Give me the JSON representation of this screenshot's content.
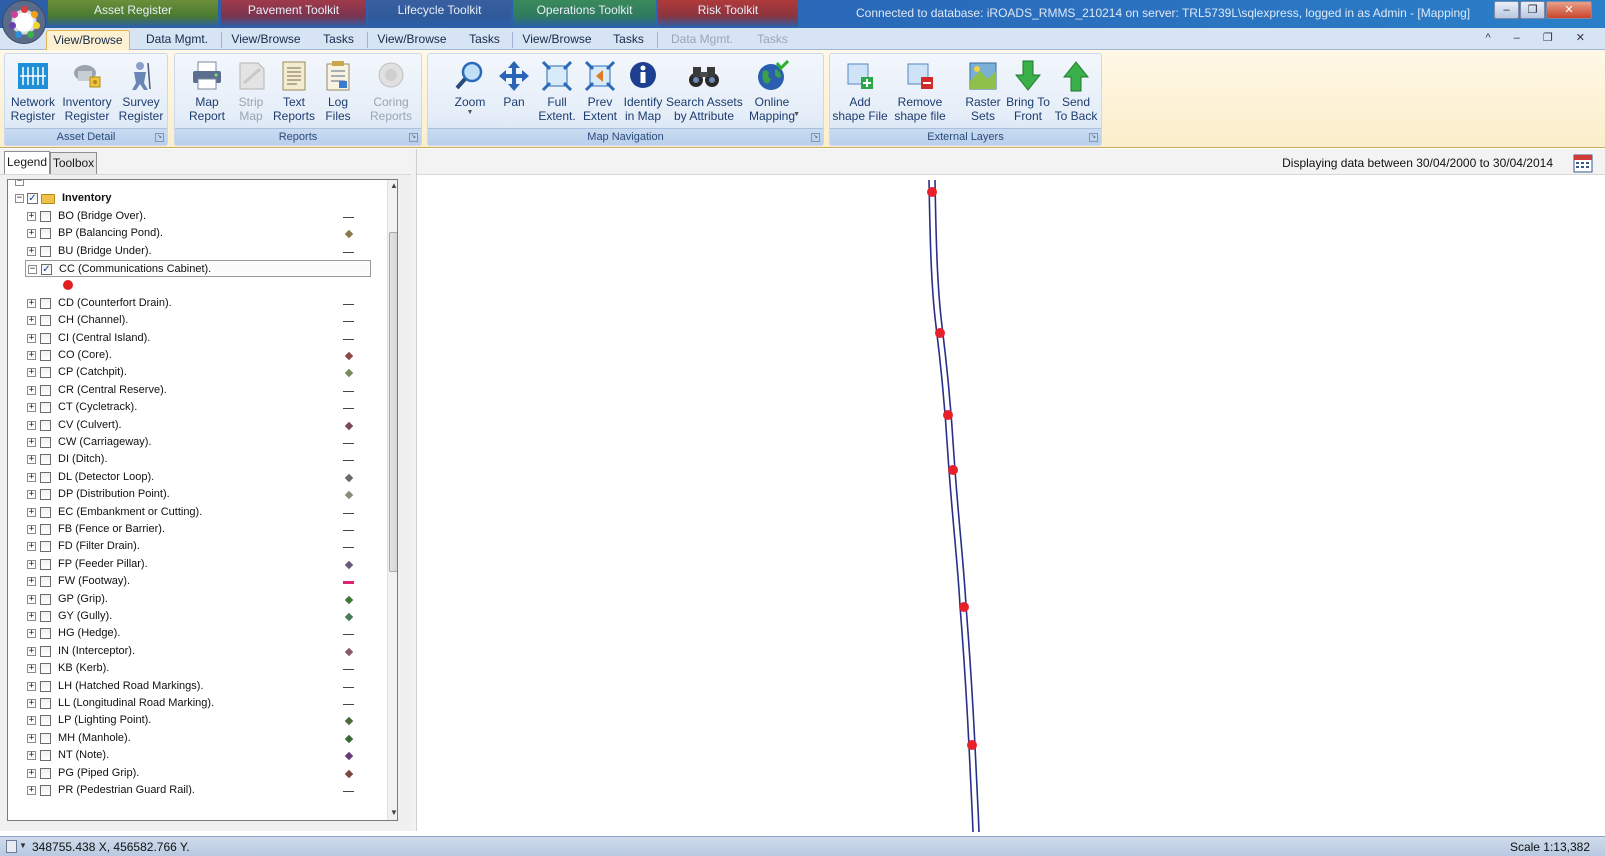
{
  "titlebar": {
    "context_tabs": [
      "Asset Register",
      "Pavement Toolkit",
      "Lifecycle Toolkit",
      "Operations Toolkit",
      "Risk Toolkit"
    ],
    "connection_text": "Connected to database: iROADS_RMMS_210214 on server: TRL5739L\\sqlexpress, logged in as Admin - [Mapping]",
    "window_buttons": [
      "–",
      "❐",
      "✕"
    ]
  },
  "ribbon_tabs": [
    {
      "label": "View/Browse",
      "state": "active"
    },
    {
      "label": "Data Mgmt.",
      "state": "normal"
    },
    {
      "label": "View/Browse",
      "state": "normal"
    },
    {
      "label": "Tasks",
      "state": "normal"
    },
    {
      "label": "View/Browse",
      "state": "normal"
    },
    {
      "label": "Tasks",
      "state": "normal"
    },
    {
      "label": "View/Browse",
      "state": "normal"
    },
    {
      "label": "Tasks",
      "state": "normal"
    },
    {
      "label": "Data Mgmt.",
      "state": "dim"
    },
    {
      "label": "Tasks",
      "state": "dim"
    }
  ],
  "mdi_controls": "^ – ❐ ✕",
  "ribbon_groups": [
    {
      "label": "Asset Detail",
      "buttons": [
        {
          "label": "Network\nRegister",
          "icon": "network-register-icon"
        },
        {
          "label": "Inventory\nRegister",
          "icon": "inventory-register-icon"
        },
        {
          "label": "Survey\nRegister",
          "icon": "survey-register-icon"
        }
      ]
    },
    {
      "label": "Reports",
      "buttons": [
        {
          "label": "Map\nReport",
          "icon": "printer-icon"
        },
        {
          "label": "Strip\nMap",
          "icon": "strip-map-icon",
          "disabled": true
        },
        {
          "label": "Text\nReports",
          "icon": "text-report-icon"
        },
        {
          "label": "Log\nFiles",
          "icon": "log-file-icon"
        },
        {
          "label": "Coring\nReports",
          "icon": "coring-icon",
          "disabled": true
        }
      ]
    },
    {
      "label": "Map Navigation",
      "buttons": [
        {
          "label": "Zoom",
          "icon": "zoom-icon",
          "dropdown": true
        },
        {
          "label": "Pan",
          "icon": "pan-icon"
        },
        {
          "label": "Full\nExtent.",
          "icon": "full-extent-icon"
        },
        {
          "label": "Prev\nExtent",
          "icon": "prev-extent-icon"
        },
        {
          "label": "Identify\nin Map",
          "icon": "info-icon"
        },
        {
          "label": "Search Assets\nby Attribute",
          "icon": "binoculars-icon"
        },
        {
          "label": "Online\nMapping",
          "icon": "globe-icon",
          "dropdown": true
        }
      ]
    },
    {
      "label": "External Layers",
      "buttons": [
        {
          "label": "Add\nshape File",
          "icon": "add-shape-icon"
        },
        {
          "label": "Remove\nshape file",
          "icon": "remove-shape-icon"
        },
        {
          "label": "Raster\nSets",
          "icon": "raster-icon"
        },
        {
          "label": "Bring To\nFront",
          "icon": "arrow-down-icon"
        },
        {
          "label": "Send\nTo Back",
          "icon": "arrow-up-icon"
        }
      ]
    }
  ],
  "panel_tabs": [
    {
      "label": "Legend",
      "active": true
    },
    {
      "label": "Toolbox",
      "active": false
    }
  ],
  "date_range_text": "Displaying data between 30/04/2000 to 30/04/2014",
  "legend": {
    "root_label": "Inventory",
    "selected_label": "CC (Communications Cabinet).",
    "selected_symbol_color": "#e02020",
    "items": [
      {
        "label": "BO (Bridge Over).",
        "sym": "dash"
      },
      {
        "label": "BP (Balancing Pond).",
        "sym": "diamond",
        "color": "#8a7a4a"
      },
      {
        "label": "BU (Bridge Under).",
        "sym": "dash"
      },
      {
        "label": "CC (Communications Cabinet).",
        "sym": "none",
        "checked": true,
        "expanded": true
      },
      {
        "label": "CD (Counterfort Drain).",
        "sym": "dash"
      },
      {
        "label": "CH (Channel).",
        "sym": "dash"
      },
      {
        "label": "CI (Central Island).",
        "sym": "dash"
      },
      {
        "label": "CO (Core).",
        "sym": "diamond",
        "color": "#8a4a4a"
      },
      {
        "label": "CP (Catchpit).",
        "sym": "diamond",
        "color": "#7a8a5a"
      },
      {
        "label": "CR (Central Reserve).",
        "sym": "dash"
      },
      {
        "label": "CT (Cycletrack).",
        "sym": "dash"
      },
      {
        "label": "CV (Culvert).",
        "sym": "diamond",
        "color": "#7a4a5a"
      },
      {
        "label": "CW (Carriageway).",
        "sym": "dash"
      },
      {
        "label": "DI (Ditch).",
        "sym": "dash"
      },
      {
        "label": "DL (Detector Loop).",
        "sym": "diamond",
        "color": "#6a6a6a"
      },
      {
        "label": "DP (Distribution Point).",
        "sym": "diamond",
        "color": "#8a8a7a"
      },
      {
        "label": "EC (Embankment or Cutting).",
        "sym": "dash"
      },
      {
        "label": "FB (Fence or Barrier).",
        "sym": "dash"
      },
      {
        "label": "FD (Filter Drain).",
        "sym": "dash"
      },
      {
        "label": "FP (Feeder Pillar).",
        "sym": "diamond",
        "color": "#6a5a7a"
      },
      {
        "label": "FW (Footway).",
        "sym": "pinkdash"
      },
      {
        "label": "GP (Grip).",
        "sym": "diamond",
        "color": "#3a7a3a"
      },
      {
        "label": "GY (Gully).",
        "sym": "diamond",
        "color": "#4a7a5a"
      },
      {
        "label": "HG (Hedge).",
        "sym": "dash"
      },
      {
        "label": "IN (Interceptor).",
        "sym": "diamond",
        "color": "#8a5a6a"
      },
      {
        "label": "KB (Kerb).",
        "sym": "dash"
      },
      {
        "label": "LH (Hatched Road Markings).",
        "sym": "dash"
      },
      {
        "label": "LL (Longitudinal Road Marking).",
        "sym": "dash"
      },
      {
        "label": "LP (Lighting Point).",
        "sym": "diamond",
        "color": "#4a6a3a"
      },
      {
        "label": "MH (Manhole).",
        "sym": "diamond",
        "color": "#3a6a3a"
      },
      {
        "label": "NT (Note).",
        "sym": "diamond",
        "color": "#6a3a7a"
      },
      {
        "label": "PG (Piped Grip).",
        "sym": "diamond",
        "color": "#7a4a3a"
      },
      {
        "label": "PR (Pedestrian Guard Rail).",
        "sym": "dash"
      }
    ]
  },
  "map": {
    "line_color": "#2a2f8a",
    "point_color": "#e8202a"
  },
  "statusbar": {
    "coordinates": "348755.438 X, 456582.766 Y.",
    "scale": "Scale 1:13,382"
  }
}
